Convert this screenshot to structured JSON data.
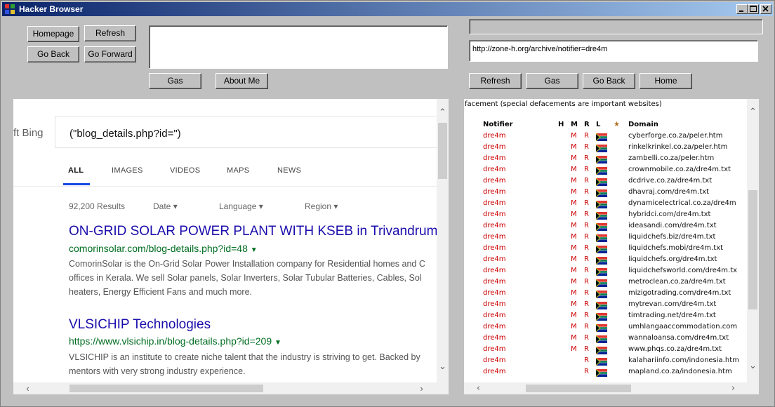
{
  "window": {
    "title": "Hacker Browser"
  },
  "left": {
    "buttons": {
      "homepage": "Homepage",
      "refresh": "Refresh",
      "go_back": "Go Back",
      "go_forward": "Go Forward",
      "gas": "Gas",
      "about_me": "About Me"
    },
    "bing": {
      "logo_text": "ft Bing",
      "query": "(\"blog_details.php?id=\")",
      "tabs": [
        "ALL",
        "IMAGES",
        "VIDEOS",
        "MAPS",
        "NEWS"
      ],
      "active_tab": "ALL",
      "results_count": "92,200 Results",
      "filters": [
        "Date",
        "Language",
        "Region"
      ],
      "results": [
        {
          "title": "ON-GRID SOLAR POWER PLANT WITH KSEB in Trivandrum",
          "url": "comorinsolar.com/blog-details.php?id=48",
          "snippet": [
            "ComorinSolar is the On-Grid Solar Power Installation company for Residential homes and C",
            "offices in Kerala. We sell Solar panels, Solar Inverters, Solar Tubular Batteries, Cables, Sol",
            "heaters, Energy Efficient Fans and much more."
          ]
        },
        {
          "title": "VLSICHIP Technologies",
          "url": "https://www.vlsichip.in/blog-details.php?id=209",
          "snippet": [
            "VLSICHIP is an institute to create niche talent that the industry is striving to get. Backed by",
            "mentors with very strong industry experience."
          ]
        }
      ]
    }
  },
  "right": {
    "url": "http://zone-h.org/archive/notifier=dre4m",
    "buttons": {
      "refresh": "Refresh",
      "gas": "Gas",
      "go_back": "Go Back",
      "home": "Home"
    },
    "zoneh": {
      "intro": "facement (special defacements are important websites)",
      "headers": {
        "notifier": "Notifier",
        "h": "H",
        "m": "M",
        "r": "R",
        "l": "L",
        "star": "★",
        "domain": "Domain"
      },
      "rows": [
        {
          "notifier": "dre4m",
          "m": "M",
          "r": "R",
          "domain": "cyberforge.co.za/peler.htm"
        },
        {
          "notifier": "dre4m",
          "m": "M",
          "r": "R",
          "domain": "rinkelkrinkel.co.za/peler.htm"
        },
        {
          "notifier": "dre4m",
          "m": "M",
          "r": "R",
          "domain": "zambelli.co.za/peler.htm"
        },
        {
          "notifier": "dre4m",
          "m": "M",
          "r": "R",
          "domain": "crownmobile.co.za/dre4m.txt"
        },
        {
          "notifier": "dre4m",
          "m": "M",
          "r": "R",
          "domain": "dcdrive.co.za/dre4m.txt"
        },
        {
          "notifier": "dre4m",
          "m": "M",
          "r": "R",
          "domain": "dhavraj.com/dre4m.txt"
        },
        {
          "notifier": "dre4m",
          "m": "M",
          "r": "R",
          "domain": "dynamicelectrical.co.za/dre4m"
        },
        {
          "notifier": "dre4m",
          "m": "M",
          "r": "R",
          "domain": "hybridci.com/dre4m.txt"
        },
        {
          "notifier": "dre4m",
          "m": "M",
          "r": "R",
          "domain": "ideasandi.com/dre4m.txt"
        },
        {
          "notifier": "dre4m",
          "m": "M",
          "r": "R",
          "domain": "liquidchefs.biz/dre4m.txt"
        },
        {
          "notifier": "dre4m",
          "m": "M",
          "r": "R",
          "domain": "liquidchefs.mobi/dre4m.txt"
        },
        {
          "notifier": "dre4m",
          "m": "M",
          "r": "R",
          "domain": "liquidchefs.org/dre4m.txt"
        },
        {
          "notifier": "dre4m",
          "m": "M",
          "r": "R",
          "domain": "liquidchefsworld.com/dre4m.tx"
        },
        {
          "notifier": "dre4m",
          "m": "M",
          "r": "R",
          "domain": "metroclean.co.za/dre4m.txt"
        },
        {
          "notifier": "dre4m",
          "m": "M",
          "r": "R",
          "domain": "mizigotrading.com/dre4m.txt"
        },
        {
          "notifier": "dre4m",
          "m": "M",
          "r": "R",
          "domain": "mytrevan.com/dre4m.txt"
        },
        {
          "notifier": "dre4m",
          "m": "M",
          "r": "R",
          "domain": "timtrading.net/dre4m.txt"
        },
        {
          "notifier": "dre4m",
          "m": "M",
          "r": "R",
          "domain": "umhlangaaccommodation.com"
        },
        {
          "notifier": "dre4m",
          "m": "M",
          "r": "R",
          "domain": "wannaloansa.com/dre4m.txt"
        },
        {
          "notifier": "dre4m",
          "m": "M",
          "r": "R",
          "domain": "www.phqs.co.za/dre4m.txt"
        },
        {
          "notifier": "dre4m",
          "m": "",
          "r": "R",
          "domain": "kalahariinfo.com/indonesia.htm"
        },
        {
          "notifier": "dre4m",
          "m": "",
          "r": "R",
          "domain": "mapland.co.za/indonesia.htm"
        }
      ]
    }
  },
  "colors": {
    "window_bg": "#c0c0c0",
    "title_start": "#0a246a",
    "title_end": "#a6caf0",
    "bing_link": "#1a0dab",
    "bing_url": "#006d21",
    "notifier_red": "#cc0000"
  }
}
